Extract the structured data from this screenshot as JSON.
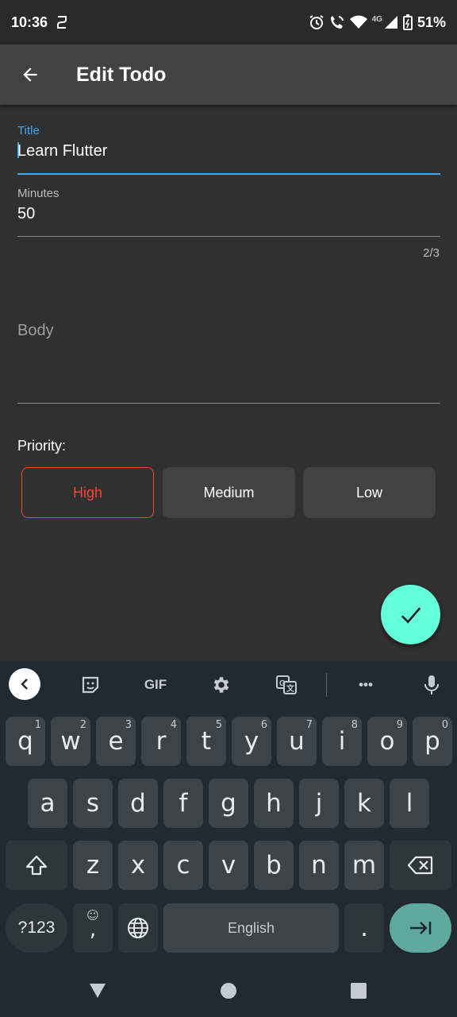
{
  "status_bar": {
    "time": "10:36",
    "network": "4G",
    "battery": "51%"
  },
  "app_bar": {
    "title": "Edit Todo"
  },
  "form": {
    "title_label": "Title",
    "title_value": "Learn Flutter",
    "minutes_label": "Minutes",
    "minutes_value": "50",
    "minutes_counter": "2/3",
    "body_placeholder": "Body",
    "priority_label": "Priority:",
    "priority_options": [
      "High",
      "Medium",
      "Low"
    ],
    "selected_priority": "High"
  },
  "keyboard": {
    "toolbar": [
      "collapse-icon",
      "sticker-icon",
      "GIF",
      "settings-icon",
      "translate-icon",
      "more-icon",
      "mic-icon"
    ],
    "gif_label": "GIF",
    "more_label": "•••",
    "row1": [
      {
        "key": "q",
        "hint": "1"
      },
      {
        "key": "w",
        "hint": "2"
      },
      {
        "key": "e",
        "hint": "3"
      },
      {
        "key": "r",
        "hint": "4"
      },
      {
        "key": "t",
        "hint": "5"
      },
      {
        "key": "y",
        "hint": "6"
      },
      {
        "key": "u",
        "hint": "7"
      },
      {
        "key": "i",
        "hint": "8"
      },
      {
        "key": "o",
        "hint": "9"
      },
      {
        "key": "p",
        "hint": "0"
      }
    ],
    "row2": [
      "a",
      "s",
      "d",
      "f",
      "g",
      "h",
      "j",
      "k",
      "l"
    ],
    "row3": [
      "z",
      "x",
      "c",
      "v",
      "b",
      "n",
      "m"
    ],
    "symbols_label": "?123",
    "emoji_hint": "☺",
    "comma": ",",
    "space_label": "English",
    "period": "."
  },
  "colors": {
    "accent": "#42a5f5",
    "fab": "#64ffda",
    "priority_high": "#f44336",
    "background": "#303030",
    "app_bar": "#424242",
    "keyboard": "#212a30"
  }
}
